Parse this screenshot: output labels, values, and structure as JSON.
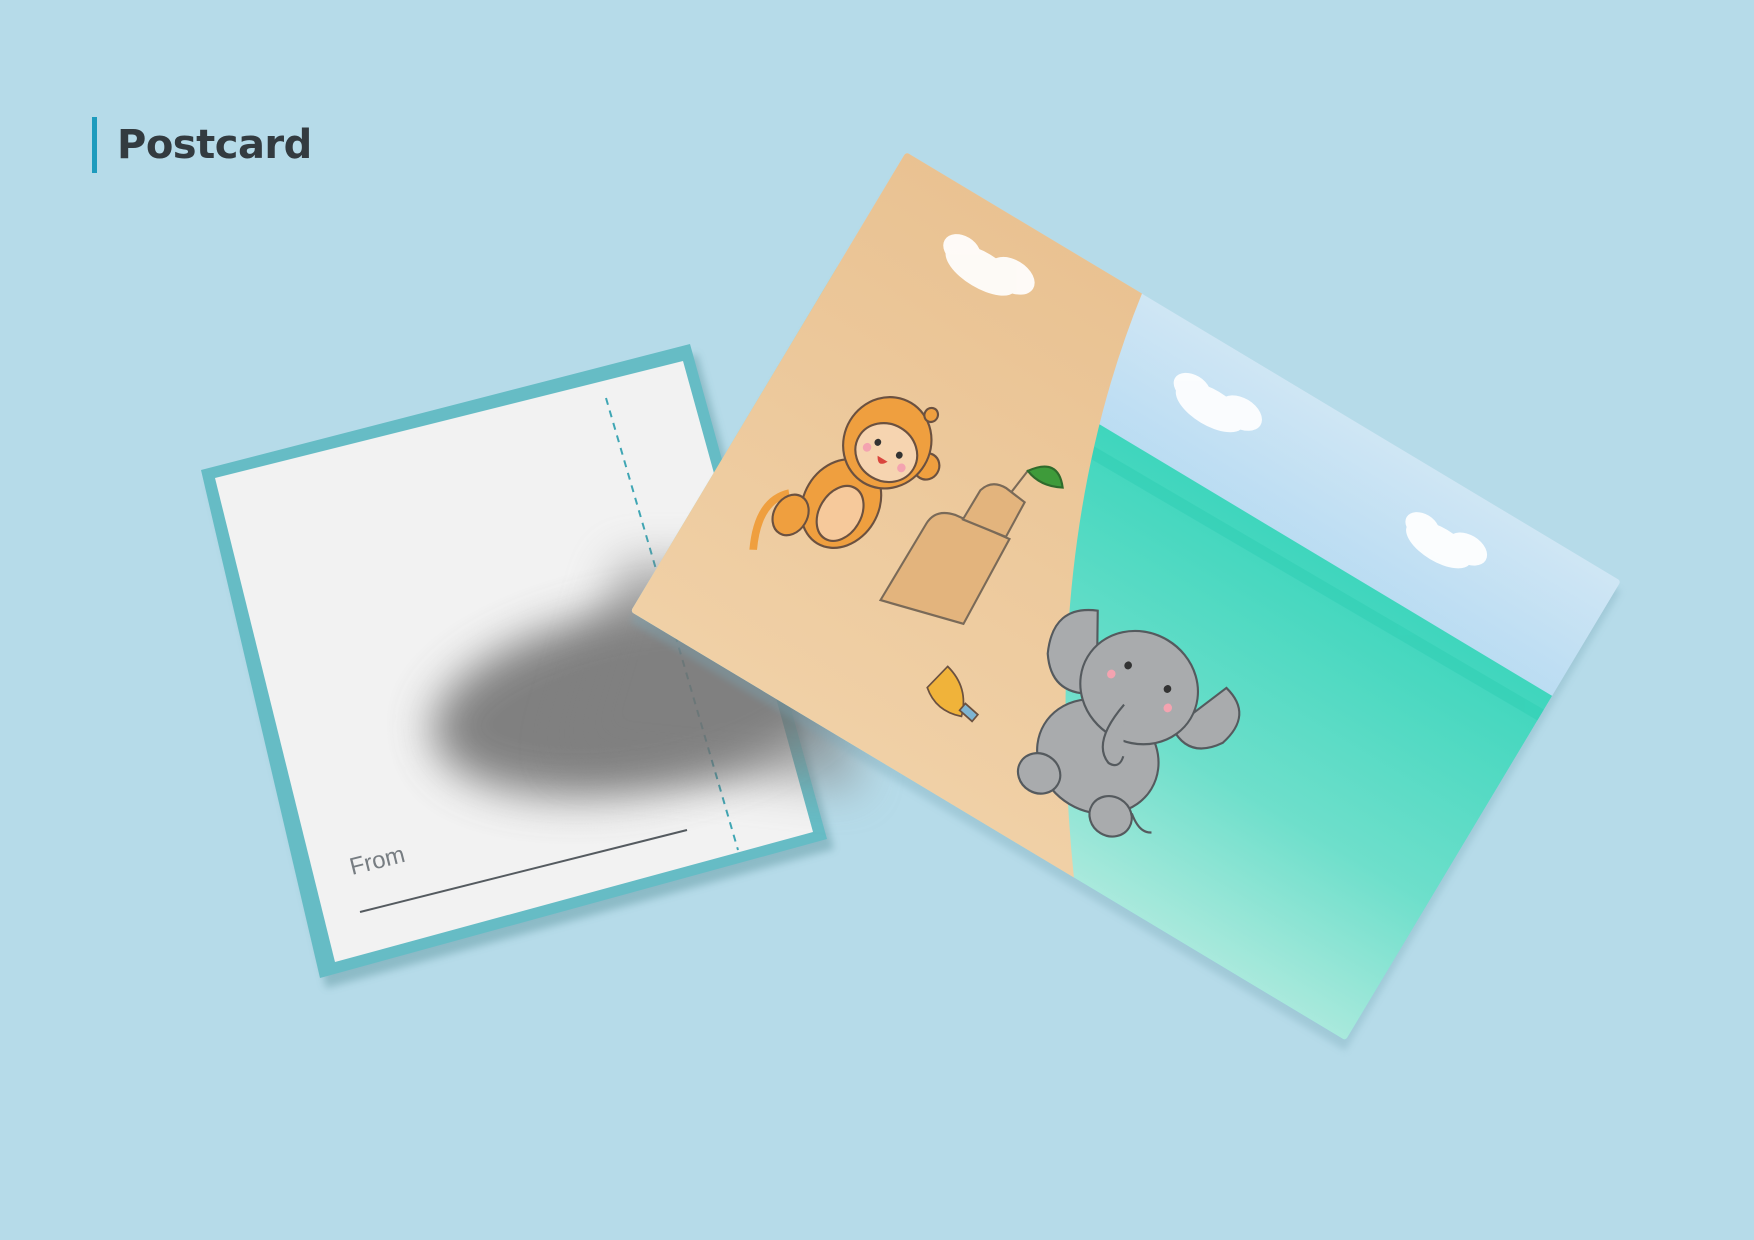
{
  "header": {
    "title": "Postcard"
  },
  "back_card": {
    "from_label": "From"
  },
  "colors": {
    "background": "#b6dbe9",
    "accent": "#1e9bbd",
    "card_border": "#66bcc5",
    "card_back": "#f2f2f2",
    "sky": "#8fc9ef",
    "sea": "#59d8c4",
    "sand": "#ecc79b",
    "monkey": "#ef9f3f",
    "elephant": "#a9abad"
  },
  "icons": [
    "monkey-illustration",
    "elephant-illustration",
    "sandcastle-illustration",
    "cloud-illustration",
    "shovel-illustration",
    "leaf-illustration"
  ]
}
